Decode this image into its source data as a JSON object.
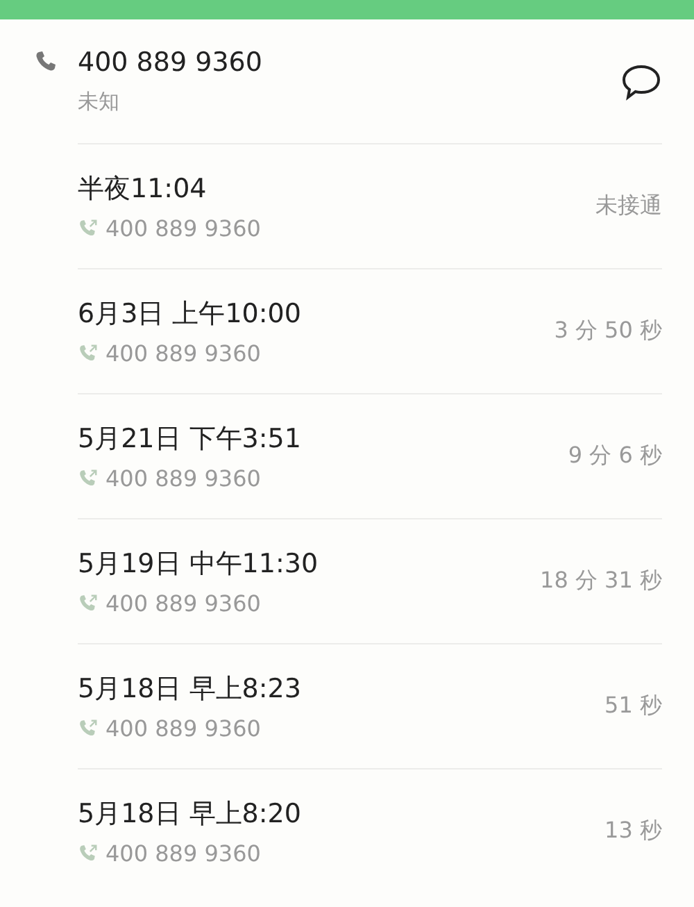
{
  "contact": {
    "number": "400 889 9360",
    "label": "未知"
  },
  "calls": [
    {
      "time": "半夜11:04",
      "number": "400 889 9360",
      "duration": "未接通"
    },
    {
      "time": "6月3日 上午10:00",
      "number": "400 889 9360",
      "duration": "3 分 50 秒"
    },
    {
      "time": "5月21日 下午3:51",
      "number": "400 889 9360",
      "duration": "9 分 6 秒"
    },
    {
      "time": "5月19日 中午11:30",
      "number": "400 889 9360",
      "duration": "18 分 31 秒"
    },
    {
      "time": "5月18日 早上8:23",
      "number": "400 889 9360",
      "duration": "51 秒"
    },
    {
      "time": "5月18日 早上8:20",
      "number": "400 889 9360",
      "duration": "13 秒"
    }
  ]
}
